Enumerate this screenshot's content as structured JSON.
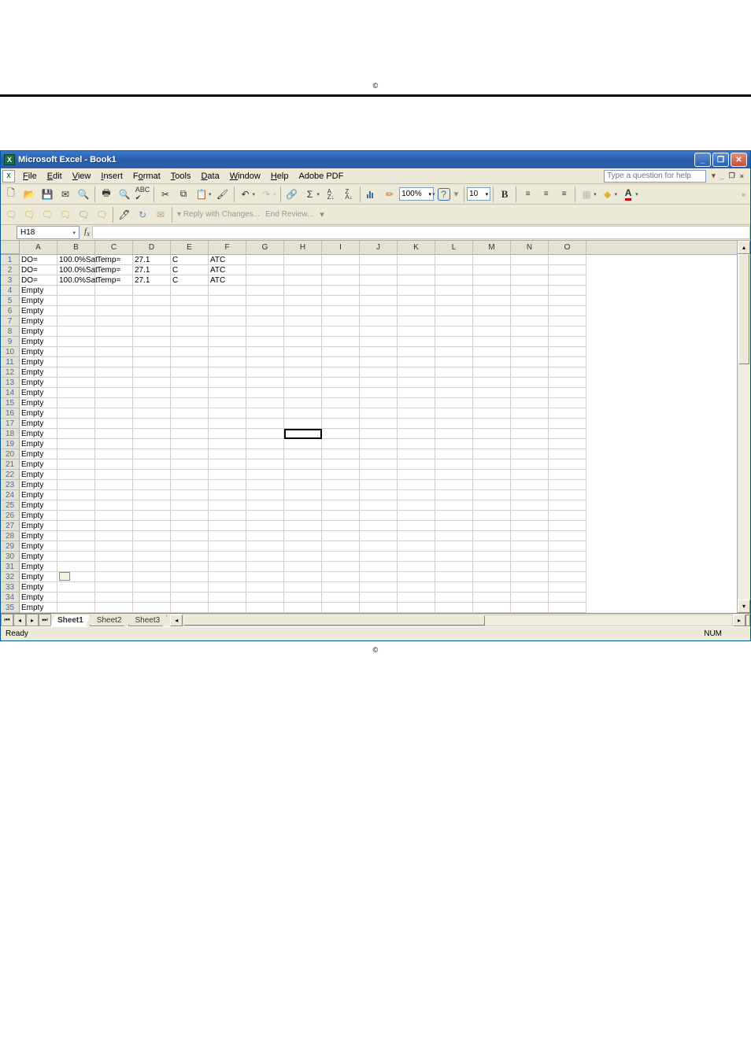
{
  "title": "Microsoft Excel - Book1",
  "menu": [
    "File",
    "Edit",
    "View",
    "Insert",
    "Format",
    "Tools",
    "Data",
    "Window",
    "Help",
    "Adobe PDF"
  ],
  "help_placeholder": "Type a question for help",
  "zoom": "100%",
  "font_size": "10",
  "toolbar2_text1": "Reply with Changes...",
  "toolbar2_text2": "End Review...",
  "namebox": "H18",
  "columns": [
    "A",
    "B",
    "C",
    "D",
    "E",
    "F",
    "G",
    "H",
    "I",
    "J",
    "K",
    "L",
    "M",
    "N",
    "O"
  ],
  "rows": [
    {
      "n": 1,
      "cells": [
        "DO=",
        "100.0%Sat",
        "Temp=",
        "27.1",
        "C",
        "ATC",
        "",
        "",
        "",
        "",
        "",
        "",
        "",
        "",
        ""
      ]
    },
    {
      "n": 2,
      "cells": [
        "DO=",
        "100.0%Sat",
        "Temp=",
        "27.1",
        "C",
        "ATC",
        "",
        "",
        "",
        "",
        "",
        "",
        "",
        "",
        ""
      ]
    },
    {
      "n": 3,
      "cells": [
        "DO=",
        "100.0%Sat",
        "Temp=",
        "27.1",
        "C",
        "ATC",
        "",
        "",
        "",
        "",
        "",
        "",
        "",
        "",
        ""
      ]
    },
    {
      "n": 4,
      "cells": [
        "Empty",
        "",
        "",
        "",
        "",
        "",
        "",
        "",
        "",
        "",
        "",
        "",
        "",
        "",
        ""
      ]
    },
    {
      "n": 5,
      "cells": [
        "Empty",
        "",
        "",
        "",
        "",
        "",
        "",
        "",
        "",
        "",
        "",
        "",
        "",
        "",
        ""
      ]
    },
    {
      "n": 6,
      "cells": [
        "Empty",
        "",
        "",
        "",
        "",
        "",
        "",
        "",
        "",
        "",
        "",
        "",
        "",
        "",
        ""
      ]
    },
    {
      "n": 7,
      "cells": [
        "Empty",
        "",
        "",
        "",
        "",
        "",
        "",
        "",
        "",
        "",
        "",
        "",
        "",
        "",
        ""
      ]
    },
    {
      "n": 8,
      "cells": [
        "Empty",
        "",
        "",
        "",
        "",
        "",
        "",
        "",
        "",
        "",
        "",
        "",
        "",
        "",
        ""
      ]
    },
    {
      "n": 9,
      "cells": [
        "Empty",
        "",
        "",
        "",
        "",
        "",
        "",
        "",
        "",
        "",
        "",
        "",
        "",
        "",
        ""
      ]
    },
    {
      "n": 10,
      "cells": [
        "Empty",
        "",
        "",
        "",
        "",
        "",
        "",
        "",
        "",
        "",
        "",
        "",
        "",
        "",
        ""
      ]
    },
    {
      "n": 11,
      "cells": [
        "Empty",
        "",
        "",
        "",
        "",
        "",
        "",
        "",
        "",
        "",
        "",
        "",
        "",
        "",
        ""
      ]
    },
    {
      "n": 12,
      "cells": [
        "Empty",
        "",
        "",
        "",
        "",
        "",
        "",
        "",
        "",
        "",
        "",
        "",
        "",
        "",
        ""
      ]
    },
    {
      "n": 13,
      "cells": [
        "Empty",
        "",
        "",
        "",
        "",
        "",
        "",
        "",
        "",
        "",
        "",
        "",
        "",
        "",
        ""
      ]
    },
    {
      "n": 14,
      "cells": [
        "Empty",
        "",
        "",
        "",
        "",
        "",
        "",
        "",
        "",
        "",
        "",
        "",
        "",
        "",
        ""
      ]
    },
    {
      "n": 15,
      "cells": [
        "Empty",
        "",
        "",
        "",
        "",
        "",
        "",
        "",
        "",
        "",
        "",
        "",
        "",
        "",
        ""
      ]
    },
    {
      "n": 16,
      "cells": [
        "Empty",
        "",
        "",
        "",
        "",
        "",
        "",
        "",
        "",
        "",
        "",
        "",
        "",
        "",
        ""
      ]
    },
    {
      "n": 17,
      "cells": [
        "Empty",
        "",
        "",
        "",
        "",
        "",
        "",
        "",
        "",
        "",
        "",
        "",
        "",
        "",
        ""
      ]
    },
    {
      "n": 18,
      "cells": [
        "Empty",
        "",
        "",
        "",
        "",
        "",
        "",
        "",
        "",
        "",
        "",
        "",
        "",
        "",
        ""
      ]
    },
    {
      "n": 19,
      "cells": [
        "Empty",
        "",
        "",
        "",
        "",
        "",
        "",
        "",
        "",
        "",
        "",
        "",
        "",
        "",
        ""
      ]
    },
    {
      "n": 20,
      "cells": [
        "Empty",
        "",
        "",
        "",
        "",
        "",
        "",
        "",
        "",
        "",
        "",
        "",
        "",
        "",
        ""
      ]
    },
    {
      "n": 21,
      "cells": [
        "Empty",
        "",
        "",
        "",
        "",
        "",
        "",
        "",
        "",
        "",
        "",
        "",
        "",
        "",
        ""
      ]
    },
    {
      "n": 22,
      "cells": [
        "Empty",
        "",
        "",
        "",
        "",
        "",
        "",
        "",
        "",
        "",
        "",
        "",
        "",
        "",
        ""
      ]
    },
    {
      "n": 23,
      "cells": [
        "Empty",
        "",
        "",
        "",
        "",
        "",
        "",
        "",
        "",
        "",
        "",
        "",
        "",
        "",
        ""
      ]
    },
    {
      "n": 24,
      "cells": [
        "Empty",
        "",
        "",
        "",
        "",
        "",
        "",
        "",
        "",
        "",
        "",
        "",
        "",
        "",
        ""
      ]
    },
    {
      "n": 25,
      "cells": [
        "Empty",
        "",
        "",
        "",
        "",
        "",
        "",
        "",
        "",
        "",
        "",
        "",
        "",
        "",
        ""
      ]
    },
    {
      "n": 26,
      "cells": [
        "Empty",
        "",
        "",
        "",
        "",
        "",
        "",
        "",
        "",
        "",
        "",
        "",
        "",
        "",
        ""
      ]
    },
    {
      "n": 27,
      "cells": [
        "Empty",
        "",
        "",
        "",
        "",
        "",
        "",
        "",
        "",
        "",
        "",
        "",
        "",
        "",
        ""
      ]
    },
    {
      "n": 28,
      "cells": [
        "Empty",
        "",
        "",
        "",
        "",
        "",
        "",
        "",
        "",
        "",
        "",
        "",
        "",
        "",
        ""
      ]
    },
    {
      "n": 29,
      "cells": [
        "Empty",
        "",
        "",
        "",
        "",
        "",
        "",
        "",
        "",
        "",
        "",
        "",
        "",
        "",
        ""
      ]
    },
    {
      "n": 30,
      "cells": [
        "Empty",
        "",
        "",
        "",
        "",
        "",
        "",
        "",
        "",
        "",
        "",
        "",
        "",
        "",
        ""
      ]
    },
    {
      "n": 31,
      "cells": [
        "Empty",
        "",
        "",
        "",
        "",
        "",
        "",
        "",
        "",
        "",
        "",
        "",
        "",
        "",
        ""
      ]
    },
    {
      "n": 32,
      "cells": [
        "Empty",
        "",
        "",
        "",
        "",
        "",
        "",
        "",
        "",
        "",
        "",
        "",
        "",
        "",
        ""
      ]
    },
    {
      "n": 33,
      "cells": [
        "Empty",
        "",
        "",
        "",
        "",
        "",
        "",
        "",
        "",
        "",
        "",
        "",
        "",
        "",
        ""
      ]
    },
    {
      "n": 34,
      "cells": [
        "Empty",
        "",
        "",
        "",
        "",
        "",
        "",
        "",
        "",
        "",
        "",
        "",
        "",
        "",
        ""
      ]
    },
    {
      "n": 35,
      "cells": [
        "Empty",
        "",
        "",
        "",
        "",
        "",
        "",
        "",
        "",
        "",
        "",
        "",
        "",
        "",
        ""
      ]
    }
  ],
  "selected": {
    "row": 18,
    "col": "H"
  },
  "sheets": [
    "Sheet1",
    "Sheet2",
    "Sheet3"
  ],
  "active_sheet": "Sheet1",
  "status": "Ready",
  "indicator": "NUM",
  "copyright": "©"
}
